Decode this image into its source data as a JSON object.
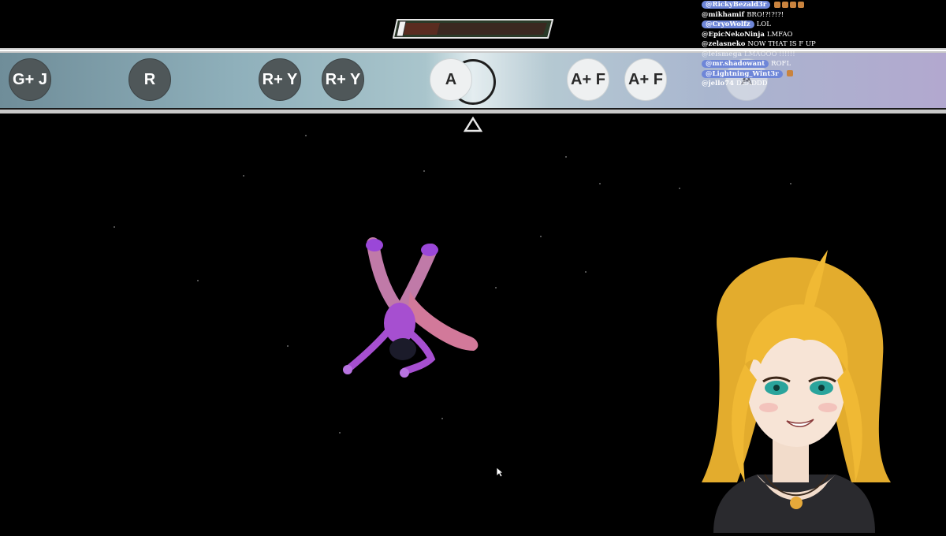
{
  "meter": {
    "fill_fraction": 0.06,
    "colors": {
      "frame": "#e0e0e0",
      "fill": "#6a3a2a"
    }
  },
  "lane": {
    "notes": [
      {
        "label": "G+ J",
        "style": "dark"
      },
      {
        "label": "R",
        "style": "dark"
      },
      {
        "label": "R+ Y",
        "style": "dark"
      },
      {
        "label": "R+ Y",
        "style": "dark"
      },
      {
        "label": "A",
        "style": "light"
      },
      {
        "label": "A+ F",
        "style": "light"
      },
      {
        "label": "A+ F",
        "style": "light"
      },
      {
        "label": "A",
        "style": "light"
      }
    ]
  },
  "chat": [
    {
      "user": "@RickyBezald3r",
      "pill": true,
      "message": "",
      "emotes": 4
    },
    {
      "user": "@mikhamif",
      "pill": false,
      "message": "BRO!?!?!?!",
      "emotes": 0
    },
    {
      "user": "@CryoWolfz",
      "pill": true,
      "message": "LOL",
      "emotes": 0
    },
    {
      "user": "@EpicNekoNinja",
      "pill": false,
      "message": "LMFAO",
      "emotes": 0
    },
    {
      "user": "@zelasneko",
      "pill": false,
      "message": "NOW THAT IS F UP",
      "emotes": 0
    },
    {
      "user": "@leismega",
      "pill": false,
      "message": "LMAOOO !!!!!!",
      "emotes": 0,
      "faded": true
    },
    {
      "user": "@mr.shadowant",
      "pill": true,
      "message": "ROFL",
      "emotes": 0
    },
    {
      "user": "@Lightning_Wint3r",
      "pill": true,
      "message": "",
      "emotes": 1
    },
    {
      "user": "@jello74",
      "pill": false,
      "message": "DEADDD",
      "emotes": 0
    }
  ],
  "icons": {
    "hit_marker": "triangle-outline-icon",
    "cursor": "mouse-pointer-icon"
  }
}
